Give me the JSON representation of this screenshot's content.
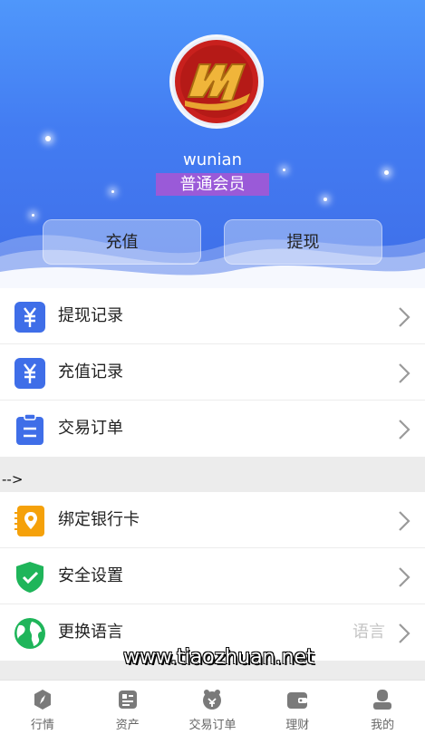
{
  "profile": {
    "username": "wunian",
    "level": "普通会员"
  },
  "header_buttons": {
    "recharge": "充值",
    "withdraw": "提现"
  },
  "menu_group_1": [
    {
      "label": "提现记录",
      "icon": "yuan-icon"
    },
    {
      "label": "充值记录",
      "icon": "yuan-icon"
    },
    {
      "label": "交易订单",
      "icon": "clipboard-icon"
    }
  ],
  "stray_text": "-->",
  "menu_group_2": [
    {
      "label": "绑定银行卡",
      "icon": "bank-card-icon"
    },
    {
      "label": "安全设置",
      "icon": "shield-check-icon"
    },
    {
      "label": "更换语言",
      "icon": "globe-icon",
      "hint": "语言"
    }
  ],
  "watermark": "www.tiaozhuan.net",
  "tabbar": [
    {
      "label": "行情",
      "icon": "market-icon"
    },
    {
      "label": "资产",
      "icon": "assets-icon"
    },
    {
      "label": "交易订单",
      "icon": "orders-icon"
    },
    {
      "label": "理财",
      "icon": "wallet-icon"
    },
    {
      "label": "我的",
      "icon": "profile-icon"
    }
  ],
  "colors": {
    "accent_blue": "#3f6ee8",
    "level_badge": "#9a5ad8",
    "orange": "#f5a10a",
    "green": "#1fb55a"
  }
}
